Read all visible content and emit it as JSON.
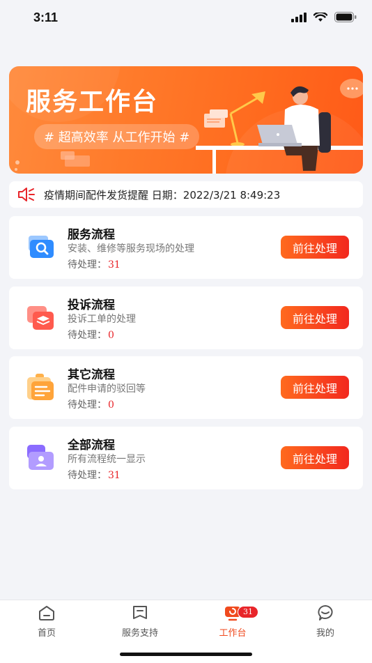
{
  "status_bar": {
    "time": "3:11"
  },
  "banner": {
    "title": "服务工作台",
    "slogan": "# 超高效率 从工作开始 #"
  },
  "notice": {
    "text": "疫情期间配件发货提醒 日期：2022/3/21 8:49:23"
  },
  "cards": [
    {
      "title": "服务流程",
      "desc": "安装、维修等服务现场的处理",
      "pending_label": "待处理：",
      "count": "31",
      "button": "前往处理",
      "icon": "magnifier-folder-icon"
    },
    {
      "title": "投诉流程",
      "desc": "投诉工单的处理",
      "pending_label": "待处理：",
      "count": "0",
      "button": "前往处理",
      "icon": "layers-icon"
    },
    {
      "title": "其它流程",
      "desc": "配件申请的驳回等",
      "pending_label": "待处理：",
      "count": "0",
      "button": "前往处理",
      "icon": "clipboard-icon"
    },
    {
      "title": "全部流程",
      "desc": "所有流程统一显示",
      "pending_label": "待处理：",
      "count": "31",
      "button": "前往处理",
      "icon": "id-card-icon"
    }
  ],
  "tabbar": {
    "items": [
      {
        "label": "首页",
        "icon": "home-icon"
      },
      {
        "label": "服务支持",
        "icon": "bookmark-icon"
      },
      {
        "label": "工作台",
        "icon": "workbench-icon",
        "badge": "31",
        "active": true
      },
      {
        "label": "我的",
        "icon": "chat-face-icon"
      }
    ]
  },
  "colors": {
    "accent": "#ff6a1e",
    "badge": "#e8252a",
    "background": "#f3f4f8"
  }
}
